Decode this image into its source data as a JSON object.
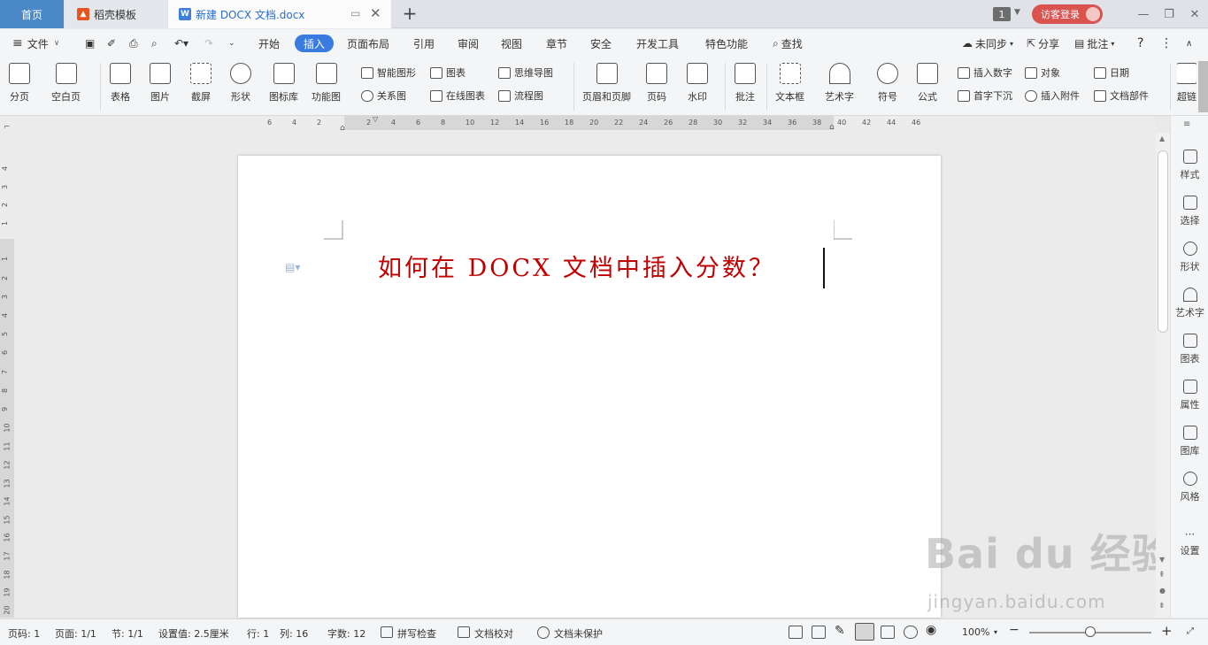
{
  "tabs": {
    "home": "首页",
    "template": "稻壳模板",
    "document": "新建 DOCX 文档.docx"
  },
  "window": {
    "badge": "1",
    "login": "访客登录"
  },
  "menu": {
    "file": "文件",
    "items": [
      "开始",
      "插入",
      "页面布局",
      "引用",
      "审阅",
      "视图",
      "章节",
      "安全",
      "开发工具",
      "特色功能"
    ],
    "search": "查找",
    "sync": "未同步",
    "share": "分享",
    "comment": "批注"
  },
  "ribbon": {
    "page_break": "分页",
    "blank_page": "空白页",
    "table": "表格",
    "picture": "图片",
    "screenshot": "截屏",
    "shape": "形状",
    "icon_lib": "图标库",
    "func_chart": "功能图",
    "smart_art": "智能图形",
    "relation": "关系图",
    "chart": "图表",
    "online_chart": "在线图表",
    "mind_map": "思维导图",
    "flowchart": "流程图",
    "header_footer": "页眉和页脚",
    "page_number": "页码",
    "watermark": "水印",
    "annotation": "批注",
    "text_box": "文本框",
    "word_art": "艺术字",
    "symbol": "符号",
    "formula": "公式",
    "insert_number": "插入数字",
    "drop_cap": "首字下沉",
    "object": "对象",
    "attachment": "插入附件",
    "date": "日期",
    "doc_parts": "文档部件",
    "hyperlink_cut": "超链"
  },
  "ruler": {
    "h_ticks": [
      "6",
      "4",
      "2",
      "2",
      "4",
      "6",
      "8",
      "10",
      "12",
      "14",
      "16",
      "18",
      "20",
      "22",
      "24",
      "26",
      "28",
      "30",
      "32",
      "34",
      "36",
      "38",
      "40",
      "42",
      "44",
      "46"
    ],
    "v_ticks": [
      "4",
      "3",
      "2",
      "1",
      "1",
      "2",
      "3",
      "4",
      "5",
      "6",
      "7",
      "8",
      "9",
      "10",
      "11",
      "12",
      "13",
      "14",
      "15",
      "16",
      "17",
      "18",
      "19",
      "20"
    ]
  },
  "document": {
    "title": "如何在 DOCX 文档中插入分数？"
  },
  "right_panel": [
    "样式",
    "选择",
    "形状",
    "艺术字",
    "图表",
    "属性",
    "图库",
    "风格",
    "设置"
  ],
  "watermark": {
    "brand": "Bai du 经验",
    "url": "jingyan.baidu.com"
  },
  "status": {
    "page": "页码: 1",
    "pages": "页面: 1/1",
    "section": "节: 1/1",
    "setting": "设置值: 2.5厘米",
    "row": "行: 1",
    "col": "列: 16",
    "words": "字数: 12",
    "spell": "拼写检查",
    "proof": "文档校对",
    "protect": "文档未保护",
    "zoom": "100%"
  },
  "colors": {
    "accent": "#3a7be0",
    "title_red": "#c00000",
    "login_red": "#d9534f"
  }
}
